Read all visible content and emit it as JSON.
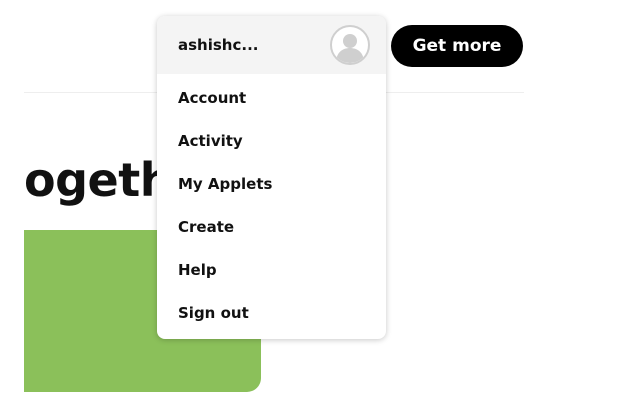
{
  "page": {
    "heading_fragment": "ogeth",
    "card_color": "#8bc05a"
  },
  "header": {
    "get_more_label": "Get more"
  },
  "user_menu": {
    "username": "ashishc...",
    "avatar_icon": "default-user-avatar",
    "items": [
      {
        "label": "Account"
      },
      {
        "label": "Activity"
      },
      {
        "label": "My Applets"
      },
      {
        "label": "Create"
      },
      {
        "label": "Help"
      },
      {
        "label": "Sign out"
      }
    ]
  }
}
